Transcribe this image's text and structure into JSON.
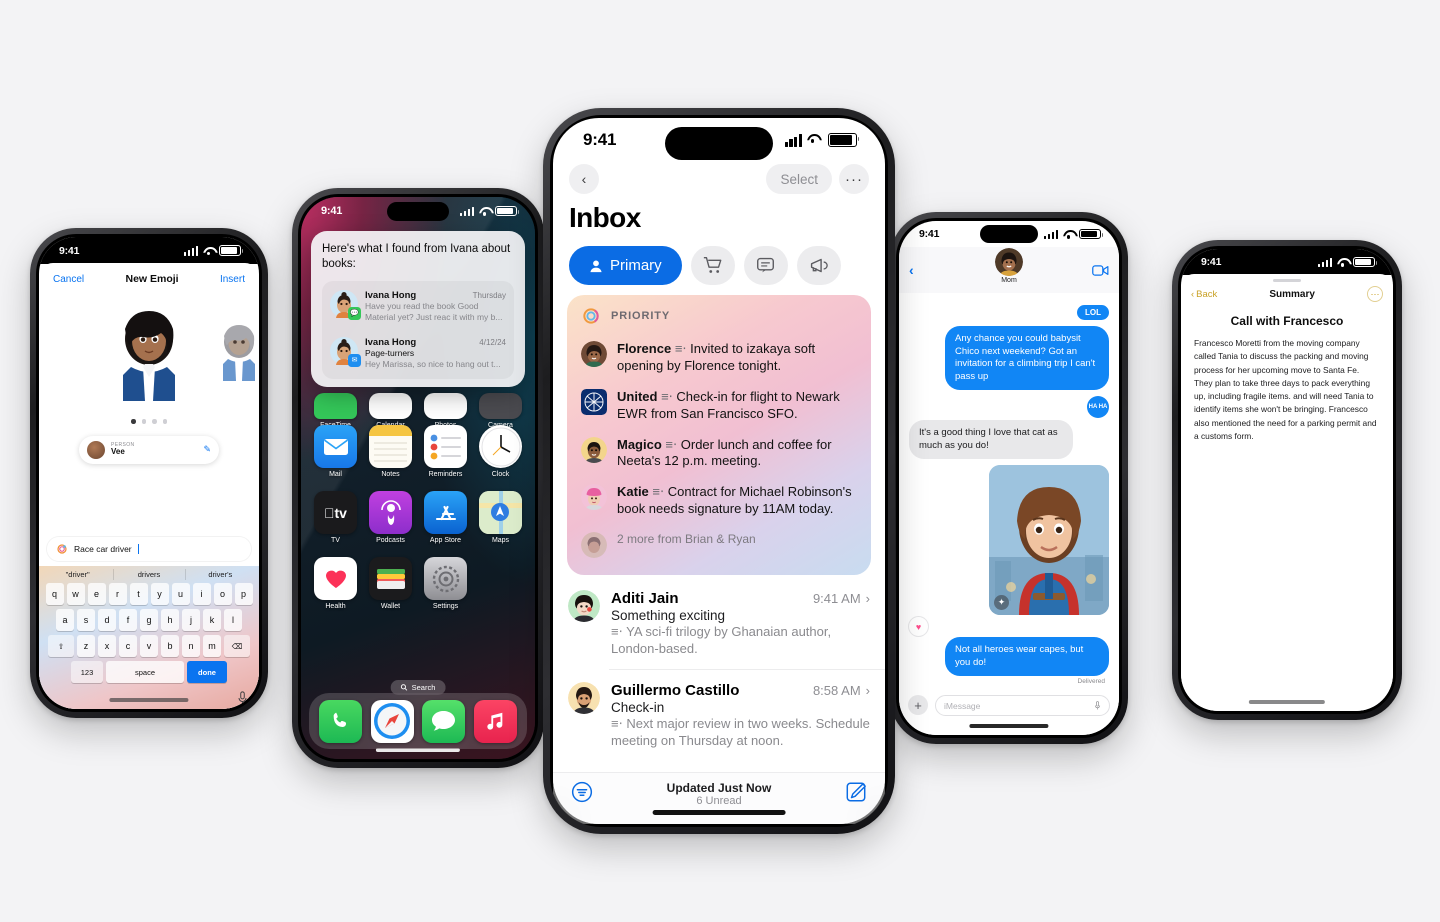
{
  "background_color": "#f3f3f5",
  "accent_blue": "#0b6ce4",
  "phone_emoji": {
    "status": {
      "time": "9:41"
    },
    "nav": {
      "cancel": "Cancel",
      "title": "New Emoji",
      "insert": "Insert"
    },
    "person_chip": {
      "kicker": "PERSON",
      "name": "Vee"
    },
    "input": {
      "value": "Race car driver"
    },
    "suggestions": [
      "\"driver\"",
      "drivers",
      "driver's"
    ],
    "keyboard": {
      "row1": [
        "q",
        "w",
        "e",
        "r",
        "t",
        "y",
        "u",
        "i",
        "o",
        "p"
      ],
      "row2": [
        "a",
        "s",
        "d",
        "f",
        "g",
        "h",
        "j",
        "k",
        "l"
      ],
      "row3": [
        "z",
        "x",
        "c",
        "v",
        "b",
        "n",
        "m"
      ],
      "shift": "⇧",
      "backspace": "⌫",
      "numbers": "123",
      "space": "space",
      "done": "done",
      "mic": "🎙"
    }
  },
  "phone_home": {
    "status": {
      "time": "9:41"
    },
    "siri": {
      "title": "Here's what I found from Ivana about books:",
      "messages": [
        {
          "name": "Ivana Hong",
          "date": "Thursday",
          "subject": "",
          "preview": "Have you read the book Good Material yet? Just reac it with my b...",
          "badge_app": "messages-badge"
        },
        {
          "name": "Ivana Hong",
          "date": "4/12/24",
          "subject": "Page-turners",
          "preview": "Hey Marissa, so nice to hang out t...",
          "badge_app": "mail-badge"
        }
      ]
    },
    "apps_row0": [
      "FaceTime",
      "Calendar",
      "Photos",
      "Camera"
    ],
    "apps": [
      {
        "label": "Mail",
        "icon": "mail-icon"
      },
      {
        "label": "Notes",
        "icon": "notes-icon"
      },
      {
        "label": "Reminders",
        "icon": "reminders-icon"
      },
      {
        "label": "Clock",
        "icon": "clock-icon"
      },
      {
        "label": "TV",
        "icon": "tv-icon"
      },
      {
        "label": "Podcasts",
        "icon": "podcasts-icon"
      },
      {
        "label": "App Store",
        "icon": "appstore-icon"
      },
      {
        "label": "Maps",
        "icon": "maps-icon"
      },
      {
        "label": "Health",
        "icon": "health-icon"
      },
      {
        "label": "Wallet",
        "icon": "wallet-icon"
      },
      {
        "label": "Settings",
        "icon": "settings-icon"
      }
    ],
    "search_label": "Search",
    "dock": [
      {
        "label": "Phone",
        "icon": "phone-icon"
      },
      {
        "label": "Safari",
        "icon": "safari-icon"
      },
      {
        "label": "Messages",
        "icon": "messages-icon"
      },
      {
        "label": "Music",
        "icon": "music-icon"
      }
    ]
  },
  "phone_mail": {
    "status": {
      "time": "9:41"
    },
    "nav": {
      "back": "‹",
      "select": "Select",
      "more": "···"
    },
    "title": "Inbox",
    "filters": [
      {
        "label": "Primary",
        "icon": "person-icon",
        "active": true
      },
      {
        "label": "Transactions",
        "icon": "cart-icon",
        "active": false
      },
      {
        "label": "Updates",
        "icon": "chat-icon",
        "active": false
      },
      {
        "label": "Promotions",
        "icon": "megaphone-icon",
        "active": false
      }
    ],
    "priority": {
      "label": "PRIORITY",
      "items": [
        {
          "sender": "Florence",
          "text": "Invited to izakaya soft opening by Florence tonight."
        },
        {
          "sender": "United",
          "text": "Check-in for flight to Newark EWR from San Francisco SFO."
        },
        {
          "sender": "Magico",
          "text": "Order lunch and coffee for Neeta's 12 p.m. meeting."
        },
        {
          "sender": "Katie",
          "text": "Contract for Michael Robinson's book needs signature by 11AM today."
        }
      ],
      "more": "2 more from Brian & Ryan"
    },
    "emails": [
      {
        "name": "Aditi Jain",
        "time": "9:41 AM",
        "subject": "Something exciting",
        "preview": "YA sci-fi trilogy by Ghanaian author, London-based."
      },
      {
        "name": "Guillermo Castillo",
        "time": "8:58 AM",
        "subject": "Check-in",
        "preview": "Next major review in two weeks. Schedule meeting on Thursday at noon."
      }
    ],
    "toolbar": {
      "status": "Updated Just Now",
      "unread": "6 Unread",
      "filter_icon": "filter-icon",
      "compose_icon": "compose-icon"
    }
  },
  "phone_messages": {
    "status": {
      "time": "9:41"
    },
    "contact": {
      "name": "Mom",
      "back_icon": "back-chevron-icon",
      "facetime_icon": "facetime-video-icon"
    },
    "thread": [
      {
        "type": "tapback",
        "label": "LOL",
        "side": "right"
      },
      {
        "type": "bubble",
        "side": "right",
        "text": "Any chance you could babysit Chico next weekend? Got an invitation for a climbing trip I can't pass up"
      },
      {
        "type": "tapback-round",
        "label": "HA HA",
        "side": "right"
      },
      {
        "type": "bubble",
        "side": "left",
        "text": "It's a good thing I love that cat as much as you do!"
      },
      {
        "type": "image",
        "side": "right",
        "alt": "genmoji-superhero-image"
      },
      {
        "type": "heart-tapback",
        "side": "left"
      },
      {
        "type": "bubble",
        "side": "right",
        "text": "Not all heroes wear capes, but you do!"
      }
    ],
    "delivered": "Delivered",
    "input": {
      "placeholder": "iMessage",
      "plus_icon": "plus-icon",
      "mic_icon": "mic-icon"
    }
  },
  "phone_summary": {
    "status": {
      "time": "9:41"
    },
    "nav": {
      "back": "Back",
      "title": "Summary",
      "more_icon": "more-circle-icon"
    },
    "heading": "Call with Francesco",
    "body": "Francesco Moretti from the moving company called Tania to discuss the packing and moving process for her upcoming move to Santa Fe. They plan to take three days to pack everything up, including fragile items. and will need Tania to identify items she won't be bringing. Francesco also mentioned the need for a parking permit and a customs form."
  }
}
